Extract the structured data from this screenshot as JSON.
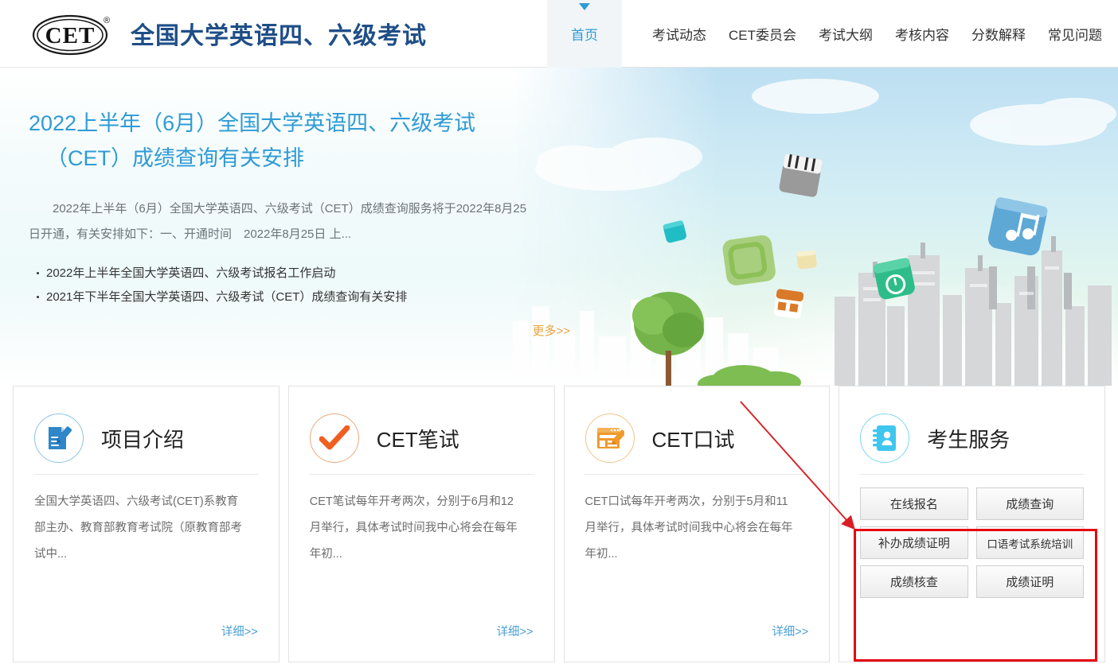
{
  "header": {
    "logo_text": "CET",
    "logo_registered": "®",
    "site_title": "全国大学英语四、六级考试",
    "nav": [
      {
        "label": "首页",
        "active": true
      },
      {
        "label": "考试动态",
        "active": false
      },
      {
        "label": "CET委员会",
        "active": false
      },
      {
        "label": "考试大纲",
        "active": false
      },
      {
        "label": "考核内容",
        "active": false
      },
      {
        "label": "分数解释",
        "active": false
      },
      {
        "label": "常见问题",
        "active": false
      }
    ]
  },
  "banner": {
    "title_line1": "2022上半年（6月）全国大学英语四、六级考试",
    "title_line2": "（CET）成绩查询有关安排",
    "description": "2022年上半年（6月）全国大学英语四、六级考试（CET）成绩查询服务将于2022年8月25日开通，有关安排如下：一、开通时间　2022年8月25日 上...",
    "list": [
      "2022年上半年全国大学英语四、六级考试报名工作启动",
      "2021年下半年全国大学英语四、六级考试（CET）成绩查询有关安排"
    ],
    "more_label": "更多>>"
  },
  "cards": [
    {
      "icon": "document-pencil-icon",
      "title": "项目介绍",
      "body": "全国大学英语四、六级考试(CET)系教育部主办、教育部教育考试院（原教育部考试中...",
      "more_label": "详细>>"
    },
    {
      "icon": "check-mark-icon",
      "title": "CET笔试",
      "body": "CET笔试每年开考两次，分别于6月和12月举行，具体考试时间我中心将会在每年年初...",
      "more_label": "详细>>"
    },
    {
      "icon": "form-pencil-icon",
      "title": "CET口试",
      "body": "CET口试每年开考两次，分别于5月和11月举行，具体考试时间我中心将会在每年年初...",
      "more_label": "详细>>"
    }
  ],
  "service_card": {
    "icon": "address-book-icon",
    "title": "考生服务",
    "buttons": [
      "在线报名",
      "成绩查询",
      "补办成绩证明",
      "口语考试系统培训",
      "成绩核查",
      "成绩证明"
    ]
  },
  "colors": {
    "brand_blue": "#1f4e87",
    "accent_blue": "#2e9bd6",
    "link_blue": "#4a9fd8",
    "more_orange": "#e8a33d",
    "annotation_red": "#e60012",
    "icon_orange": "#ef7c2b",
    "icon_amber": "#ef9a2b",
    "icon_cyan": "#3fc6ee"
  },
  "annotation": {
    "type": "red-arrow-and-box",
    "target": "service_card.buttons"
  }
}
